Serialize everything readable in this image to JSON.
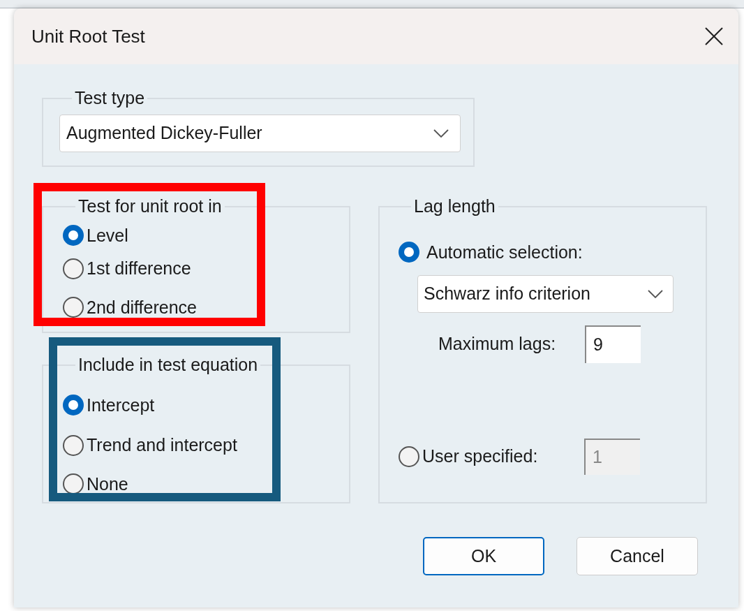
{
  "window": {
    "title": "Unit Root Test"
  },
  "test_type": {
    "label": "Test type",
    "value": "Augmented Dickey-Fuller"
  },
  "unit_root_in": {
    "label": "Test for unit root in",
    "color": "#ff0000",
    "options": [
      {
        "label": "Level",
        "selected": true
      },
      {
        "label": "1st difference",
        "selected": false
      },
      {
        "label": "2nd difference",
        "selected": false
      }
    ]
  },
  "include": {
    "label": "Include in test equation",
    "color": "#165a7e",
    "options": [
      {
        "label": "Intercept",
        "selected": true
      },
      {
        "label": "Trend and intercept",
        "selected": false
      },
      {
        "label": "None",
        "selected": false
      }
    ]
  },
  "lag_length": {
    "label": "Lag length",
    "options": [
      {
        "kind": "automatic",
        "label": "Automatic selection:",
        "selected": true,
        "criterion": "Schwarz info criterion",
        "max_lags_label": "Maximum lags:",
        "max_lags": "9"
      },
      {
        "kind": "user",
        "label": "User specified:",
        "selected": false,
        "value": "1"
      }
    ]
  },
  "buttons": [
    {
      "label": "OK",
      "focused": true
    },
    {
      "label": "Cancel",
      "focused": false
    }
  ]
}
